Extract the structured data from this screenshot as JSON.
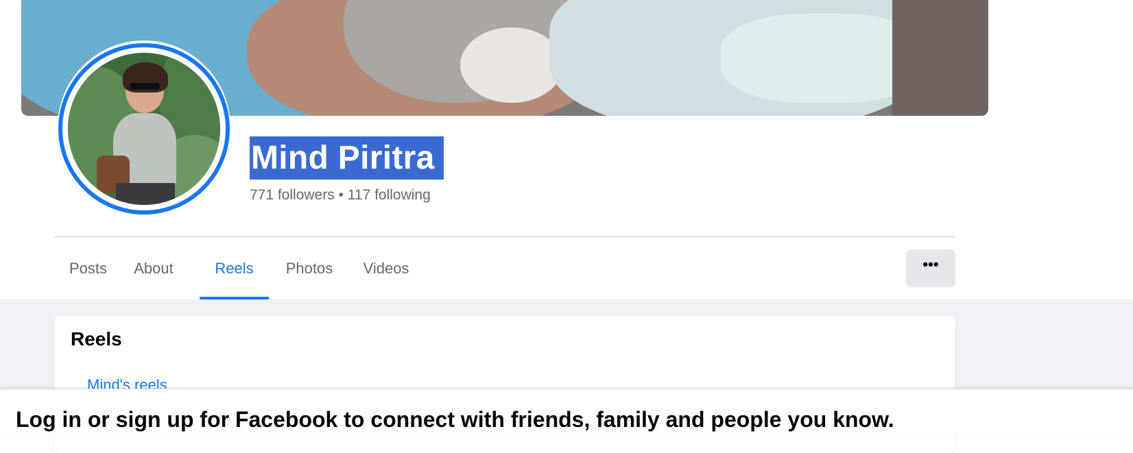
{
  "profile": {
    "name": "Mind Piritra",
    "stats": "771 followers • 117 following"
  },
  "tabs": [
    {
      "label": "Posts"
    },
    {
      "label": "About"
    },
    {
      "label": "Reels"
    },
    {
      "label": "Photos"
    },
    {
      "label": "Videos"
    }
  ],
  "active_tab": "Reels",
  "more_button": {
    "label": "•••"
  },
  "reels_section": {
    "title": "Reels",
    "link": "Mind's reels"
  },
  "login_banner": {
    "text": "Log in or sign up for Facebook to connect with friends, family and people you know."
  },
  "colors": {
    "accent": "#1877f2",
    "name_highlight": "#3b6bd0",
    "page_bg": "#f0f2f5"
  }
}
